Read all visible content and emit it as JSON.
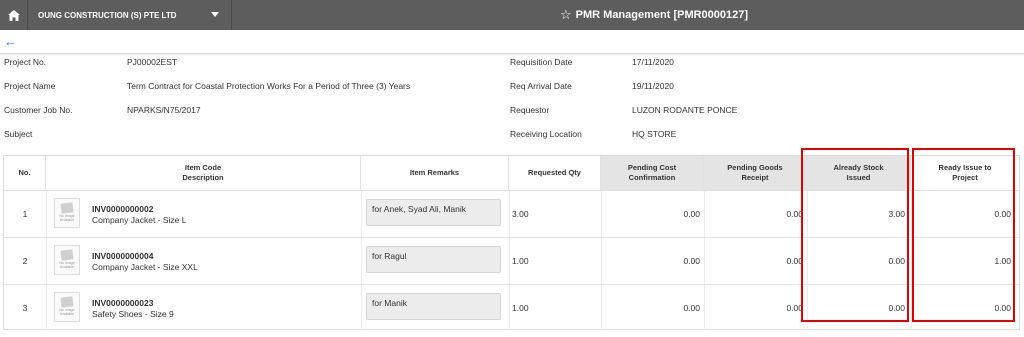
{
  "header": {
    "company": "OUNG CONSTRUCTION (S) PTE LTD",
    "title": "PMR Management [PMR0000127]"
  },
  "info": {
    "left": [
      {
        "label": "Project No.",
        "value": "PJ00002EST"
      },
      {
        "label": "Project Name",
        "value": "Term Contract for Coastal Protection Works For a Period of Three (3) Years"
      },
      {
        "label": "Customer Job No.",
        "value": "NPARKS/N75/2017"
      },
      {
        "label": "Subject",
        "value": ""
      }
    ],
    "right": [
      {
        "label": "Requisition Date",
        "value": "17/11/2020"
      },
      {
        "label": "Req Arrival Date",
        "value": "19/11/2020"
      },
      {
        "label": "Requestor",
        "value": "LUZON RODANTE PONCE"
      },
      {
        "label": "Receiving Location",
        "value": "HQ STORE"
      }
    ]
  },
  "table": {
    "headers": {
      "no": "No.",
      "item_code_line1": "Item Code",
      "item_code_line2": "Description",
      "remarks": "Item Remarks",
      "requested": "Requested Qty",
      "pending_cost_line1": "Pending Cost",
      "pending_cost_line2": "Confirmation",
      "pending_goods_line1": "Pending Goods",
      "pending_goods_line2": "Receipt",
      "stock_issued_line1": "Already Stock",
      "stock_issued_line2": "Issued",
      "ready_issue_line1": "Ready Issue to",
      "ready_issue_line2": "Project"
    },
    "no_image_caption": "No Image Available",
    "rows": [
      {
        "no": "1",
        "code": "INV0000000002",
        "desc": "Company Jacket - Size L",
        "remark": "for Anek, Syad Ali, Manik",
        "requested": "3.00",
        "pending_cost": "0.00",
        "pending_goods": "0.00",
        "stock_issued": "3.00",
        "ready_issue": "0.00"
      },
      {
        "no": "2",
        "code": "INV0000000004",
        "desc": "Company Jacket - Size XXL",
        "remark": "for Ragul",
        "requested": "1.00",
        "pending_cost": "0.00",
        "pending_goods": "0.00",
        "stock_issued": "0.00",
        "ready_issue": "1.00"
      },
      {
        "no": "3",
        "code": "INV0000000023",
        "desc": "Safety Shoes - Size 9",
        "remark": "for Manik",
        "requested": "1.00",
        "pending_cost": "0.00",
        "pending_goods": "0.00",
        "stock_issued": "0.00",
        "ready_issue": "0.00"
      }
    ]
  },
  "colors": {
    "highlight": "#e00000",
    "topbar": "#5d5d5d",
    "accent": "#2a7fd4"
  }
}
